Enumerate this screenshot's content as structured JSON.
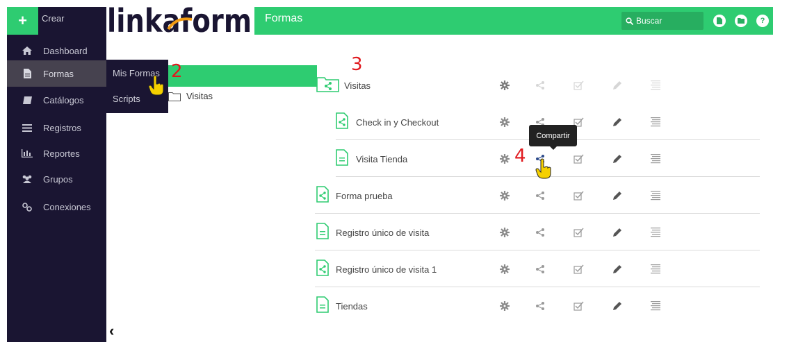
{
  "app": {
    "title": "Formas",
    "create_label": "Crear",
    "logo_text": "linkaform"
  },
  "sidebar": {
    "items": [
      {
        "label": "Dashboard",
        "icon": "home-icon"
      },
      {
        "label": "Formas",
        "icon": "document-icon"
      },
      {
        "label": "Catálogos",
        "icon": "book-icon"
      },
      {
        "label": "Registros",
        "icon": "list-icon"
      },
      {
        "label": "Reportes",
        "icon": "bar-chart-icon"
      },
      {
        "label": "Grupos",
        "icon": "group-icon"
      },
      {
        "label": "Conexiones",
        "icon": "connections-icon"
      }
    ],
    "submenu": [
      "Mis Formas",
      "Scripts"
    ]
  },
  "header": {
    "search_label": "Buscar"
  },
  "tree": {
    "folder": "Visitas"
  },
  "forms": [
    {
      "title": "Visitas",
      "kind": "folder"
    },
    {
      "title": "Check in y Checkout",
      "kind": "shared"
    },
    {
      "title": "Visita Tienda",
      "kind": "form"
    },
    {
      "title": "Forma prueba",
      "kind": "shared"
    },
    {
      "title": "Registro único de visita",
      "kind": "form"
    },
    {
      "title": "Registro único de visita 1",
      "kind": "shared"
    },
    {
      "title": "Tiendas",
      "kind": "form"
    }
  ],
  "tooltip": "Compartir",
  "annotations": [
    "2",
    "3",
    "4"
  ],
  "colors": {
    "accent": "#2ecc71",
    "sidebar": "#1a1532",
    "annotation": "#e0191e"
  }
}
